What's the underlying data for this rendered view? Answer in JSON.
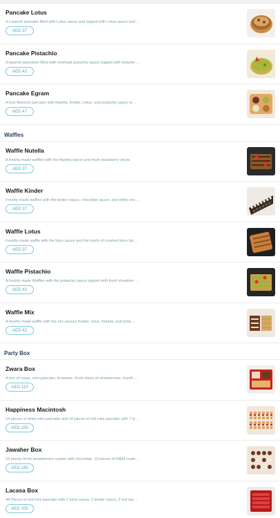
{
  "sections": [
    {
      "title": null,
      "items": [
        {
          "name": "Pancake Lotus",
          "desc": "3-Layered pancake filled with Lotus sauce and topped with Lotus sauce and L ...",
          "price": "AED 37",
          "image_icon": "pancake-lotus-photo"
        },
        {
          "name": "Pancake Pistachio",
          "desc": "3-layered pancakes filled with overload pistachio sauce topped with strawbe ...",
          "price": "AED 42",
          "image_icon": "pancake-pistachio-photo"
        },
        {
          "name": "Pancake Egram",
          "desc": "A four-flavored pancake with Nutella, Kinder, Lotus, and pistachio sauce to ...",
          "price": "AED 47",
          "image_icon": "pancake-egram-photo"
        }
      ]
    },
    {
      "title": "Waffles",
      "items": [
        {
          "name": "Waffle Nutella",
          "desc": "A freshly made waffles with the Nutella sauce and fresh strawberry slices.",
          "price": "AED 37",
          "image_icon": "waffle-nutella-photo"
        },
        {
          "name": "Waffle Kinder",
          "desc": "Freshly made waffles with the kinder sauce, chocolate sauce, and white choc ...",
          "price": "AED 37",
          "image_icon": "waffle-kinder-photo"
        },
        {
          "name": "Waffle Lotus",
          "desc": "Freshly made waffle with the lotus sauce and the touch of crushed lotus bis ...",
          "price": "AED 37",
          "image_icon": "waffle-lotus-photo"
        },
        {
          "name": "Waffle Pistachio",
          "desc": "A freshly made Waffles with the pistachio sauce topped with fresh strawberr ...",
          "price": "AED 42",
          "image_icon": "waffle-pistachio-photo"
        },
        {
          "name": "Waffle Mix",
          "desc": "A freshly made waffle with the mix sauces Kinder, lotus, Nutella, and pista ...",
          "price": "AED 42",
          "image_icon": "waffle-mix-photo"
        }
      ]
    },
    {
      "title": "Party Box",
      "items": [
        {
          "name": "Zwara Box",
          "desc": "A box of crepe, mini pancake, brownies, fresh slices of strawberries, marsh ...",
          "price": "AED 110",
          "image_icon": "zwara-box-photo"
        },
        {
          "name": "Happiness Macintosh",
          "desc": "24 pieces of white mini pancake and 24 pieces of red mini pancake with 7 ty ...",
          "price": "AED 100",
          "image_icon": "happiness-macintosh-photo"
        },
        {
          "name": "Jawaher Box",
          "desc": "15 pieces fresh strawberries coated with chocolate, 10 pieces of M&M coated ...",
          "price": "AED 165",
          "image_icon": "jawaher-box-photo"
        },
        {
          "name": "Lacasa Box",
          "desc": "48 Pieces of red mini pancake with 2 lotus sauce, 2 kinder sauce, 2 red ras ...",
          "price": "AED 100",
          "image_icon": "lacasa-box-photo"
        }
      ]
    }
  ],
  "colors": {
    "price_border": "#7fc7d4",
    "price_text": "#4ea9b9",
    "desc_text": "#7aa0ab",
    "section_title": "#2b3f5c"
  }
}
